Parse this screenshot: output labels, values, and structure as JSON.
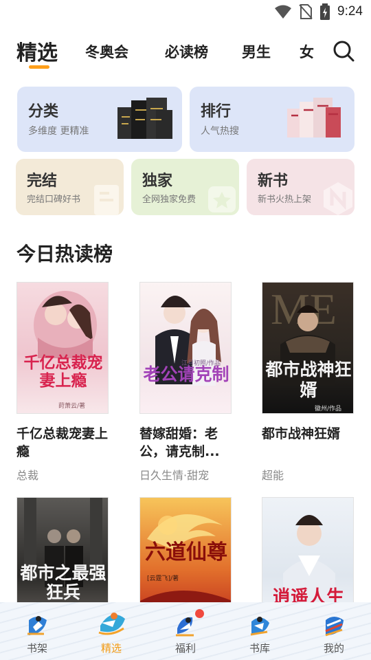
{
  "status_bar": {
    "time": "9:24"
  },
  "top_tabs": [
    {
      "label": "精选",
      "active": true
    },
    {
      "label": "冬奥会",
      "active": false
    },
    {
      "label": "必读榜",
      "active": false
    },
    {
      "label": "男生",
      "active": false
    },
    {
      "label": "女",
      "active": false
    }
  ],
  "categories": {
    "fenlei": {
      "title": "分类",
      "subtitle": "多维度 更精准"
    },
    "paihang": {
      "title": "排行",
      "subtitle": "人气热搜"
    },
    "wanjie": {
      "title": "完结",
      "subtitle": "完结口碑好书"
    },
    "dujia": {
      "title": "独家",
      "subtitle": "全网独家免费"
    },
    "xinshu": {
      "title": "新书",
      "subtitle": "新书火热上架"
    }
  },
  "section": {
    "title": "今日热读榜"
  },
  "books": [
    {
      "name": "千亿总裁宠妻上瘾",
      "tag": "总裁",
      "cover_text": "千亿总裁宠妻上瘾",
      "cover_author": "莳萧云/著"
    },
    {
      "name": "替嫁甜婚：老公，请克制...",
      "tag": "日久生情·甜宠",
      "cover_text": "老公请克制",
      "cover_author": "江月初照/作品"
    },
    {
      "name": "都市战神狂婿",
      "tag": "超能",
      "cover_text": "都市战神狂婿",
      "cover_author": "徽州/作品"
    },
    {
      "name": "",
      "tag": "",
      "cover_text": "都市之最强狂兵",
      "cover_author": ""
    },
    {
      "name": "",
      "tag": "",
      "cover_text": "六道仙尊",
      "cover_author": "[云霆飞]/著"
    },
    {
      "name": "",
      "tag": "",
      "cover_text": "逍遥人生",
      "cover_author": ""
    }
  ],
  "bottom_nav": [
    {
      "label": "书架",
      "icon": "skater-icon",
      "active": false
    },
    {
      "label": "精选",
      "icon": "skier-icon",
      "active": true
    },
    {
      "label": "福利",
      "icon": "speed-skater-icon",
      "active": false,
      "badge": true
    },
    {
      "label": "书库",
      "icon": "snowboard-icon",
      "active": false
    },
    {
      "label": "我的",
      "icon": "ski-jump-icon",
      "active": false
    }
  ],
  "colors": {
    "accent": "#ff9f1a",
    "card_blue": "#dde5f8",
    "card_beige": "#f3ead8",
    "card_green": "#e6f1d6",
    "card_pink": "#f5e3e6",
    "badge": "#f0493e"
  }
}
